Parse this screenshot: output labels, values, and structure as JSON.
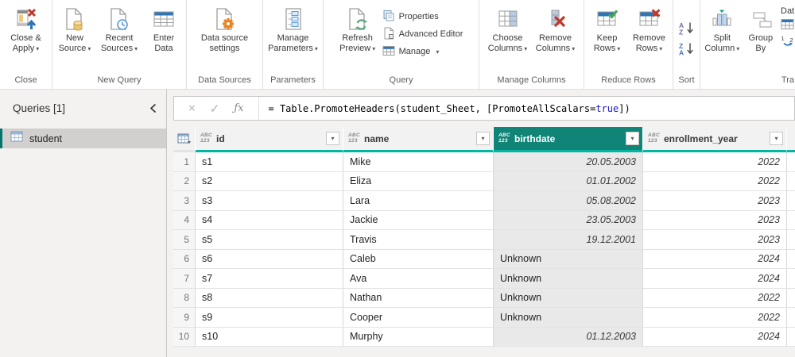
{
  "icons": {
    "caret": "▾"
  },
  "colors": {
    "accent_teal": "#00b7a3",
    "selected_header": "#0f8477",
    "query_selected_bar": "#00756b",
    "formula_keyword_blue": "#1a1ac4"
  },
  "ribbon": {
    "buttons": {
      "close_apply": "Close &\nApply",
      "new_source": "New\nSource",
      "recent_sources": "Recent\nSources",
      "enter_data": "Enter\nData",
      "data_source_settings": "Data source\nsettings",
      "manage_parameters": "Manage\nParameters",
      "refresh_preview": "Refresh\nPreview",
      "properties": "Properties",
      "advanced_editor": "Advanced Editor",
      "manage": "Manage",
      "choose_columns": "Choose\nColumns",
      "remove_columns": "Remove\nColumns",
      "keep_rows": "Keep\nRows",
      "remove_rows": "Remove\nRows",
      "split_column": "Split\nColumn",
      "group_by": "Group\nBy",
      "data_type_partial": "Dat"
    },
    "groups": {
      "close": "Close",
      "new_query": "New Query",
      "data_sources": "Data Sources",
      "parameters": "Parameters",
      "query": "Query",
      "manage_columns": "Manage Columns",
      "reduce_rows": "Reduce Rows",
      "sort": "Sort",
      "transform_partial": "Tra"
    }
  },
  "formula": {
    "cancel": "×",
    "check": "✓",
    "fx": "ƒx",
    "prefix": "= Table.PromoteHeaders(student_Sheet, [PromoteAllScalars=",
    "highlight": "true",
    "suffix": "])"
  },
  "queries": {
    "title": "Queries [1]",
    "items": [
      {
        "name": "student",
        "selected": true
      }
    ]
  },
  "grid": {
    "type_badge": {
      "top": "ABC",
      "bottom": "123"
    },
    "columns": [
      {
        "label": "id",
        "selected": false
      },
      {
        "label": "name",
        "selected": false
      },
      {
        "label": "birthdate",
        "selected": true
      },
      {
        "label": "enrollment_year",
        "selected": false
      }
    ],
    "rows": [
      [
        "1",
        "s1",
        "Mike",
        "20.05.2003",
        "2022"
      ],
      [
        "2",
        "s2",
        "Eliza",
        "01.01.2002",
        "2022"
      ],
      [
        "3",
        "s3",
        "Lara",
        "05.08.2002",
        "2023"
      ],
      [
        "4",
        "s4",
        "Jackie",
        "23.05.2003",
        "2023"
      ],
      [
        "5",
        "s5",
        "Travis",
        "19.12.2001",
        "2023"
      ],
      [
        "6",
        "s6",
        "Caleb",
        "Unknown",
        "2024"
      ],
      [
        "7",
        "s7",
        "Ava",
        "Unknown",
        "2024"
      ],
      [
        "8",
        "s8",
        "Nathan",
        "Unknown",
        "2022"
      ],
      [
        "9",
        "s9",
        "Cooper",
        "Unknown",
        "2022"
      ],
      [
        "10",
        "s10",
        "Murphy",
        "01.12.2003",
        "2024"
      ]
    ]
  }
}
